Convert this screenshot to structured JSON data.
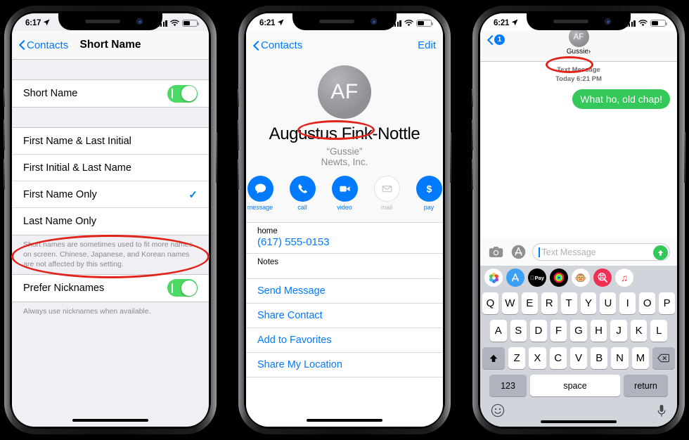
{
  "meta": {
    "background": "#000000",
    "accent_blue": "#007aff",
    "green": "#34c759",
    "annotation_red": "#e2231a"
  },
  "phone1": {
    "status": {
      "time": "6:17",
      "location_icon": "location-arrow-icon",
      "signal": "signal-bars-icon",
      "wifi": "wifi-icon",
      "battery": "battery-icon"
    },
    "nav": {
      "back_label": "Contacts",
      "title": "Short Name",
      "back_icon": "chevron-left-icon"
    },
    "short_name_row": {
      "label": "Short Name",
      "toggle_state": "on"
    },
    "options": [
      {
        "label": "First Name & Last Initial",
        "selected": false
      },
      {
        "label": "First Initial & Last Name",
        "selected": false
      },
      {
        "label": "First Name Only",
        "selected": true,
        "check": "✓"
      },
      {
        "label": "Last Name Only",
        "selected": false
      }
    ],
    "footnote_1": "Short names are sometimes used to fit more names on screen. Chinese, Japanese, and Korean names are not affected by this setting.",
    "nickname_row": {
      "label": "Prefer Nicknames",
      "toggle_state": "on"
    },
    "footnote_2": "Always use nicknames when available."
  },
  "phone2": {
    "status": {
      "time": "6:21",
      "location_icon": "location-arrow-icon"
    },
    "nav": {
      "back_label": "Contacts",
      "edit_label": "Edit",
      "back_icon": "chevron-left-icon"
    },
    "avatar_initials": "AF",
    "full_name": "Augustus Fink-Nottle",
    "nickname": "“Gussie”",
    "company": "Newts, Inc.",
    "actions": [
      {
        "label": "message",
        "icon": "message-bubble-icon",
        "enabled": true
      },
      {
        "label": "call",
        "icon": "phone-icon",
        "enabled": true
      },
      {
        "label": "video",
        "icon": "video-camera-icon",
        "enabled": true
      },
      {
        "label": "mail",
        "icon": "envelope-icon",
        "enabled": false
      },
      {
        "label": "pay",
        "icon": "dollar-sign-icon",
        "enabled": true
      }
    ],
    "phone_field": {
      "label": "home",
      "value": "(617) 555-0153"
    },
    "notes_field": {
      "label": "Notes",
      "value": ""
    },
    "links": [
      "Send Message",
      "Share Contact",
      "Add to Favorites",
      "Share My Location"
    ]
  },
  "phone3": {
    "status": {
      "time": "6:21",
      "location_icon": "location-arrow-icon"
    },
    "nav": {
      "back_icon": "chevron-left-icon",
      "unread_badge": "1"
    },
    "contact": {
      "avatar_initials": "AF",
      "name": "Gussie",
      "disclosure": "›"
    },
    "timestamp": {
      "line1": "Text Message",
      "line2": "Today 6:21 PM"
    },
    "messages": [
      {
        "text": "What ho, old chap!",
        "side": "outgoing",
        "color": "#34c759"
      }
    ],
    "composer": {
      "camera_icon": "camera-icon",
      "appstore_icon": "app-store-icon",
      "placeholder": "Text Message",
      "value": "",
      "send_icon": "arrow-up-icon"
    },
    "app_strip": [
      {
        "name": "photos-app-icon"
      },
      {
        "name": "app-store-app-icon"
      },
      {
        "name": "apple-pay-app-icon",
        "label": "Pay"
      },
      {
        "name": "activity-rings-app-icon"
      },
      {
        "name": "animoji-monkey-app-icon",
        "label": "🐵"
      },
      {
        "name": "images-search-app-icon"
      },
      {
        "name": "music-app-icon",
        "label": "♫"
      }
    ],
    "keyboard": {
      "row1": [
        "Q",
        "W",
        "E",
        "R",
        "T",
        "Y",
        "U",
        "I",
        "O",
        "P"
      ],
      "row2": [
        "A",
        "S",
        "D",
        "F",
        "G",
        "H",
        "J",
        "K",
        "L"
      ],
      "row3": [
        "Z",
        "X",
        "C",
        "V",
        "B",
        "N",
        "M"
      ],
      "shift_icon": "shift-arrow-icon",
      "backspace_icon": "backspace-icon",
      "numbers_label": "123",
      "space_label": "space",
      "return_label": "return",
      "emoji_icon": "emoji-smiley-icon",
      "dictation_icon": "microphone-icon"
    }
  },
  "annotations": [
    {
      "target": "prefer-nicknames-row",
      "shape": "ellipse"
    },
    {
      "target": "contact-nickname",
      "shape": "ellipse"
    },
    {
      "target": "thread-contact-name",
      "shape": "ellipse"
    }
  ]
}
